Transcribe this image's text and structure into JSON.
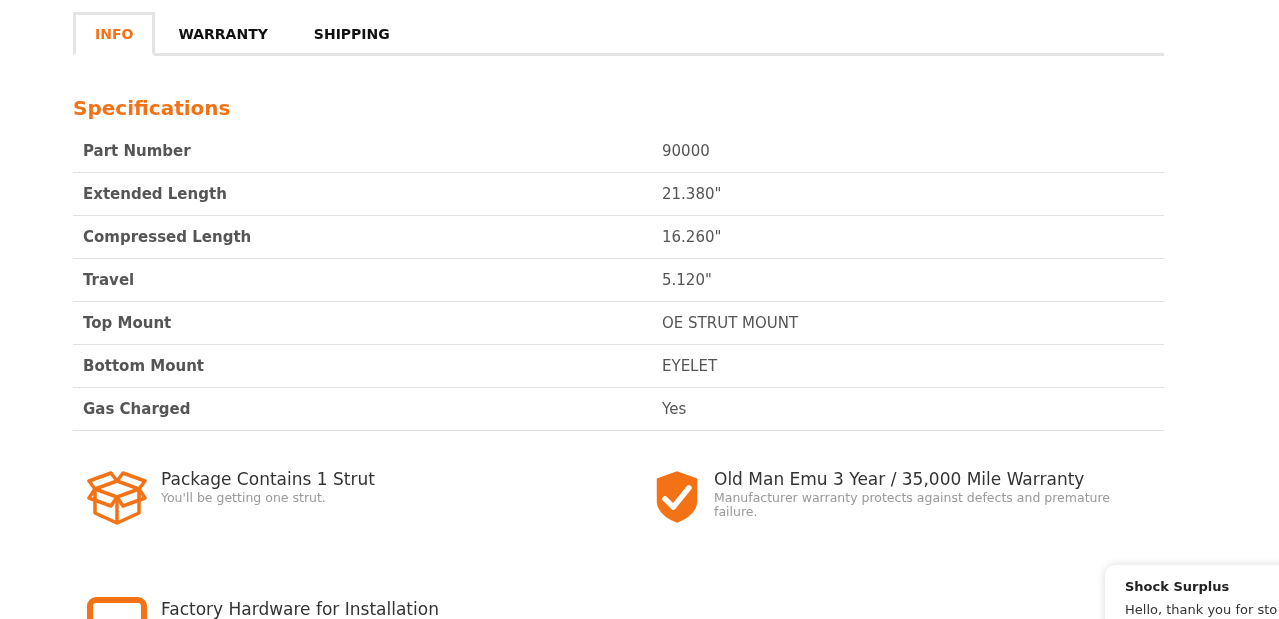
{
  "tabs": [
    {
      "label": "INFO",
      "selected": true
    },
    {
      "label": "WARRANTY",
      "selected": false
    },
    {
      "label": "SHIPPING",
      "selected": false
    }
  ],
  "specifications": {
    "title": "Specifications",
    "rows": [
      {
        "label": "Part Number",
        "value": "90000"
      },
      {
        "label": "Extended Length",
        "value": "21.380\""
      },
      {
        "label": "Compressed Length",
        "value": "16.260\""
      },
      {
        "label": "Travel",
        "value": "5.120\""
      },
      {
        "label": "Top Mount",
        "value": "OE STRUT MOUNT"
      },
      {
        "label": "Bottom Mount",
        "value": "EYELET"
      },
      {
        "label": "Gas Charged",
        "value": "Yes"
      }
    ]
  },
  "features": [
    {
      "title": "Package Contains 1 Strut",
      "description": "You'll be getting one strut."
    },
    {
      "title": "Old Man Emu 3 Year / 35,000 Mile Warranty",
      "description": "Manufacturer warranty protects against defects and premature failure."
    },
    {
      "title": "Factory Hardware for Installation"
    }
  ],
  "chat_popup": {
    "title": "Shock Surplus",
    "message": "Hello, thank you for sto"
  }
}
